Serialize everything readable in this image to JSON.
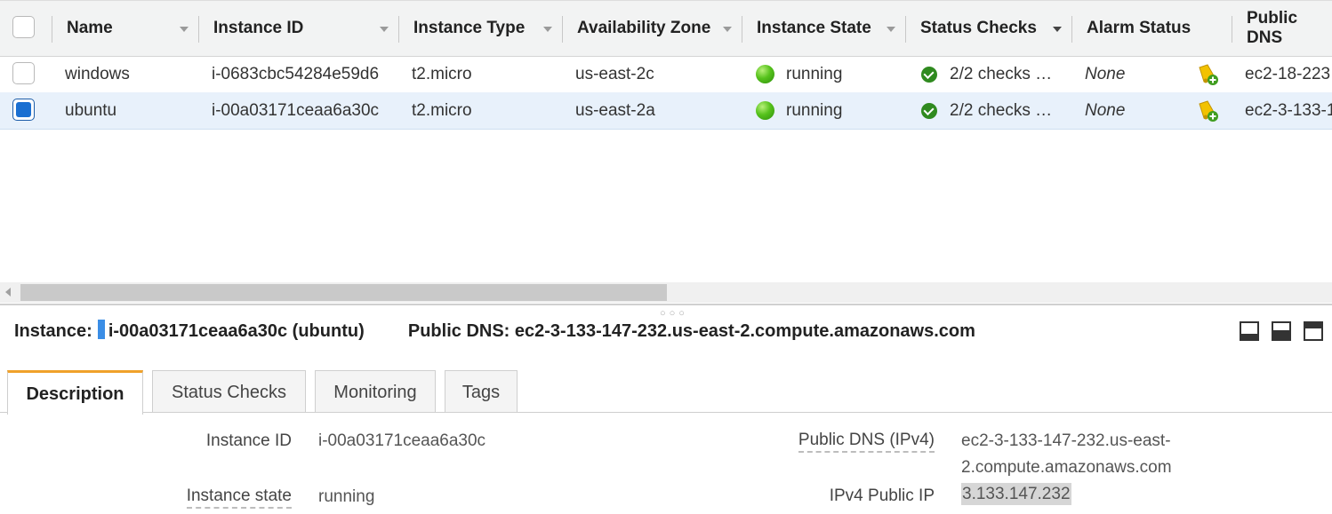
{
  "table": {
    "columns": [
      {
        "label": "Name"
      },
      {
        "label": "Instance ID"
      },
      {
        "label": "Instance Type"
      },
      {
        "label": "Availability Zone"
      },
      {
        "label": "Instance State"
      },
      {
        "label": "Status Checks"
      },
      {
        "label": "Alarm Status"
      },
      {
        "label": "Public DNS"
      }
    ],
    "rows": [
      {
        "name": "windows",
        "instance_id": "i-0683cbc54284e59d6",
        "type": "t2.micro",
        "zone": "us-east-2c",
        "state": "running",
        "checks": "2/2 checks …",
        "alarm": "None",
        "public_dns": "ec2-18-223",
        "selected": false
      },
      {
        "name": "ubuntu",
        "instance_id": "i-00a03171ceaa6a30c",
        "type": "t2.micro",
        "zone": "us-east-2a",
        "state": "running",
        "checks": "2/2 checks …",
        "alarm": "None",
        "public_dns": "ec2-3-133-1",
        "selected": true
      }
    ]
  },
  "details": {
    "instance_label": "Instance:",
    "instance_value": "i-00a03171ceaa6a30c (ubuntu)",
    "dns_label": "Public DNS:",
    "dns_value": "ec2-3-133-147-232.us-east-2.compute.amazonaws.com",
    "tabs": [
      "Description",
      "Status Checks",
      "Monitoring",
      "Tags"
    ],
    "active_tab": "Description",
    "fields": {
      "instance_id_label": "Instance ID",
      "instance_id_value": "i-00a03171ceaa6a30c",
      "instance_state_label": "Instance state",
      "instance_state_value": "running",
      "public_dns_label": "Public DNS (IPv4)",
      "public_dns_line1": "ec2-3-133-147-232.us-east-",
      "public_dns_line2": "2.compute.amazonaws.com",
      "ipv4_label": "IPv4 Public IP",
      "ipv4_value": "3.133.147.232"
    }
  },
  "icons": {
    "running": "green-circle-icon",
    "checks": "check-circle-icon",
    "alarm": "add-alarm-bell-icon",
    "panes": [
      "pane-bottom-small-icon",
      "pane-bottom-large-icon",
      "pane-top-icon"
    ]
  },
  "colors": {
    "header_bg": "#f2f3f3",
    "selected_row_bg": "#e8f1fb",
    "running_green": "#56c21c",
    "active_tab_accent": "#f0a12a",
    "selection_blue": "#1a6fd1"
  }
}
